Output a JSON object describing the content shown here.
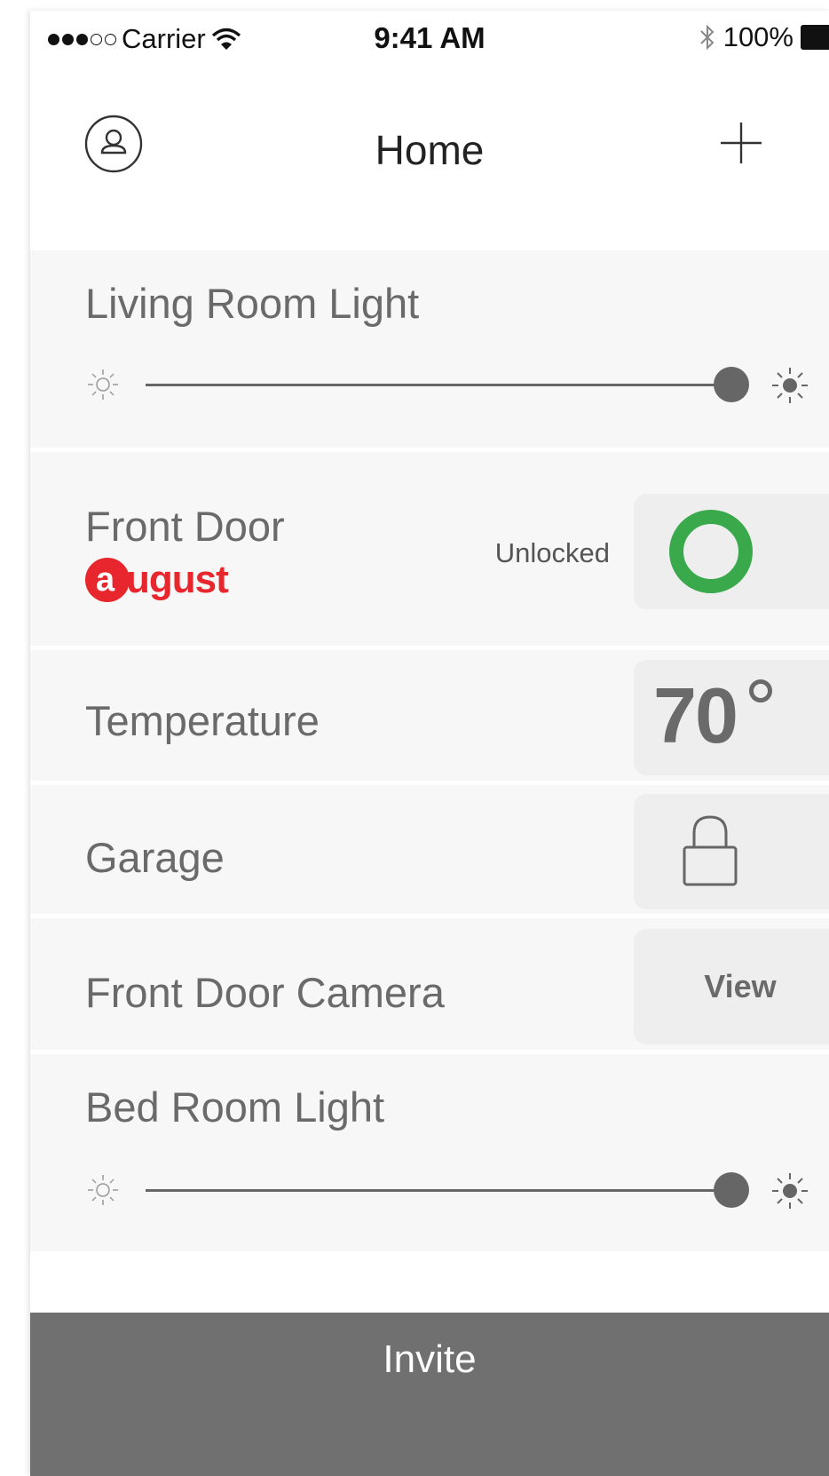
{
  "status_bar": {
    "carrier": "Carrier",
    "time": "9:41 AM",
    "battery": "100%",
    "icons": [
      "signal-dots-icon",
      "wifi-icon",
      "bluetooth-icon",
      "battery-icon"
    ]
  },
  "nav": {
    "title": "Home",
    "left_icon": "profile-icon",
    "right_icon": "plus-icon"
  },
  "devices": {
    "living_room_light": {
      "title": "Living Room Light",
      "brightness_percent": 100
    },
    "front_door": {
      "title": "Front Door",
      "brand_initial": "a",
      "brand": "ugust",
      "status": "Unlocked",
      "status_color": "#3aa94c"
    },
    "temperature": {
      "title": "Temperature",
      "value": "70"
    },
    "garage": {
      "title": "Garage",
      "icon": "lock-icon"
    },
    "front_door_camera": {
      "title": "Front Door Camera",
      "action": "View"
    },
    "bed_room_light": {
      "title": "Bed Room Light",
      "brightness_percent": 100
    }
  },
  "footer": {
    "invite_label": "Invite",
    "color": "#707070"
  },
  "colors": {
    "accent_red": "#e8262d",
    "accent_green": "#3aa94c",
    "row_bg": "#f7f7f7"
  }
}
